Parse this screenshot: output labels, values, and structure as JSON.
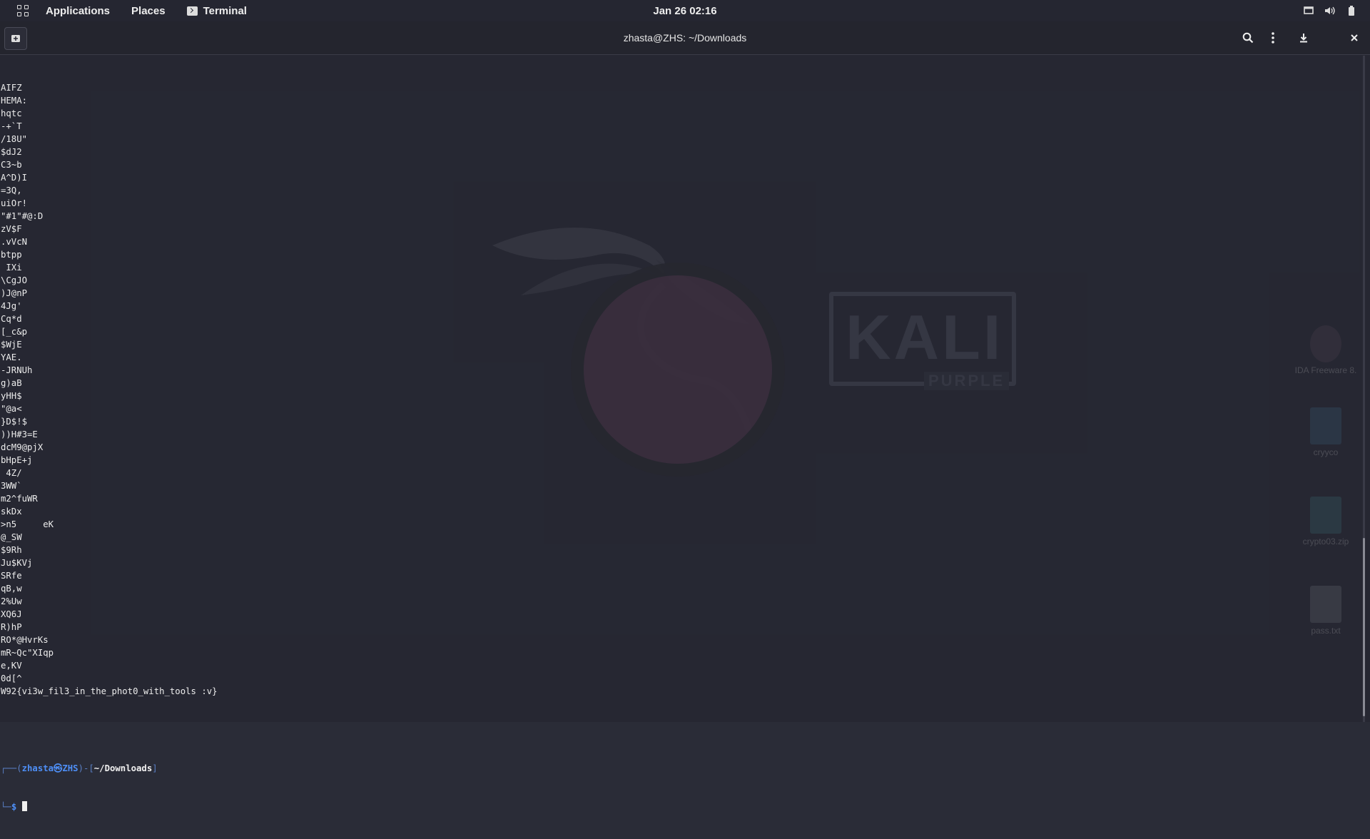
{
  "top_panel": {
    "menu": [
      {
        "label": "Applications"
      },
      {
        "label": "Places"
      },
      {
        "label": "Terminal"
      }
    ],
    "clock": "Jan 26  02:16",
    "tray_icons": [
      "screen-icon",
      "volume-icon",
      "battery-icon"
    ]
  },
  "window": {
    "title": "zhasta@ZHS: ~/Downloads",
    "header_icons": [
      "new-tab-icon",
      "search-icon",
      "kebab-menu-icon",
      "download-icon",
      "close-icon"
    ]
  },
  "wallpaper": {
    "brand": "KALI",
    "edition": "PURPLE"
  },
  "desktop_icons": [
    {
      "label": "IDA Freeware 8."
    },
    {
      "label": "cryyco"
    },
    {
      "label": "crypto03.zip"
    },
    {
      "label": "pass.txt"
    }
  ],
  "terminal": {
    "lines": [
      "AIFZ",
      "HEMA:",
      "hqtc",
      "-+`T",
      "/18U\"",
      "$dJ2",
      "C3~b",
      "A^D)I",
      "=3Q,",
      "uiOr!",
      "\"#1\"#@:D",
      "zV$F",
      ".vVcN",
      "btpp",
      " IXi",
      "\\CgJO",
      ")J@nP",
      "4Jg'",
      "Cq*d",
      "[_c&p",
      "$WjE",
      "YAE.",
      "-JRNUh",
      "g)aB",
      "yHH$",
      "\"@a<",
      "}D$!$",
      "))H#3=E",
      "dcM9@pjX",
      "bHpE+j",
      " 4Z/",
      "3WW`",
      "m2^fuWR",
      "skDx",
      ">n5     eK",
      "@_SW",
      "$9Rh",
      "Ju$KVj",
      "SRfe",
      "qB,w",
      "2%Uw",
      "XQ6J",
      "R)hP",
      "RO*@HvrKs",
      "mR~Qc\"XIqp",
      "e,KV",
      "0d[^",
      "W92{vi3w_fil3_in_the_phot0_with_tools :v}"
    ],
    "prompt": {
      "corner_top": "┌──(",
      "user_host": "zhasta㉿ZHS",
      "mid": ")-[",
      "path": "~/Downloads",
      "end": "]",
      "corner_bottom": "└─",
      "symbol": "$"
    }
  },
  "colors": {
    "panel_bg": "#252631",
    "terminal_bg": "#2a2c37",
    "prompt_blue": "#4e8ff7"
  }
}
